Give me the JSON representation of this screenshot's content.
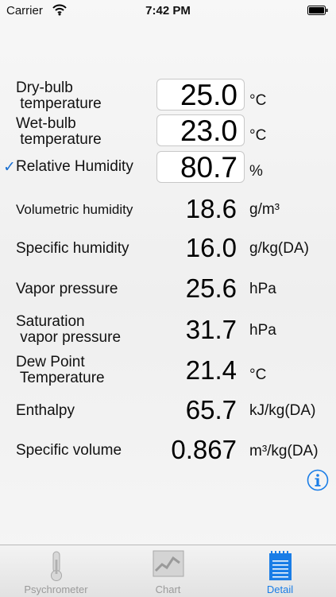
{
  "status_bar": {
    "carrier": "Carrier",
    "time": "7:42 PM",
    "icons": [
      "wifi-icon",
      "battery-icon"
    ]
  },
  "inputs": [
    {
      "label": "Dry-bulb\n temperature",
      "value": "25.0",
      "unit": "°C",
      "checked": false
    },
    {
      "label": "Wet-bulb\n temperature",
      "value": "23.0",
      "unit": "°C",
      "checked": false
    },
    {
      "label": "Relative Humidity",
      "value": "80.7",
      "unit": "%",
      "checked": true,
      "check_mark": "✓"
    }
  ],
  "results": [
    {
      "label": "Volumetric humidity",
      "value": "18.6",
      "unit": "g/m³"
    },
    {
      "label": "Specific humidity",
      "value": "16.0",
      "unit": "g/kg(DA)"
    },
    {
      "label": "Vapor pressure",
      "value": "25.6",
      "unit": "hPa"
    },
    {
      "label": "Saturation\n vapor pressure",
      "value": "31.7",
      "unit": "hPa"
    },
    {
      "label": "Dew Point\n Temperature",
      "value": "21.4",
      "unit": "°C"
    },
    {
      "label": "Enthalpy",
      "value": "65.7",
      "unit": "kJ/kg(DA)"
    },
    {
      "label": "Specific volume",
      "value": "0.867",
      "unit": "m³/kg(DA)"
    }
  ],
  "info_icon": "info-icon",
  "tabs": [
    {
      "label": "Psychrometer",
      "icon": "thermometer-icon",
      "active": false
    },
    {
      "label": "Chart",
      "icon": "chart-icon",
      "active": false
    },
    {
      "label": "Detail",
      "icon": "notepad-icon",
      "active": true
    }
  ],
  "colors": {
    "accent": "#1a7de6",
    "inactive_tab": "#9a9a9a",
    "background": "#f2f2f2"
  }
}
